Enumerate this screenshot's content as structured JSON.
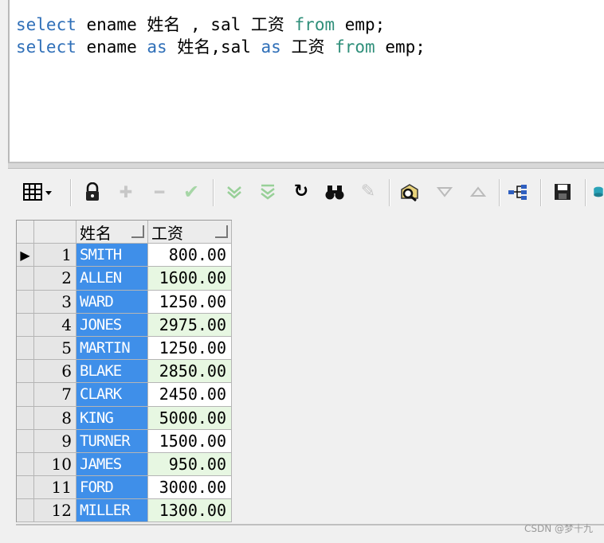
{
  "editor": {
    "lines": [
      [
        "select",
        " ename ",
        "姓名 , sal 工资 ",
        "from",
        " emp;"
      ],
      [
        "select",
        " ename ",
        "as",
        " 姓名,sal ",
        "as",
        " 工资 ",
        "from",
        " emp;"
      ]
    ]
  },
  "toolbar": {
    "buttons": [
      "grid-icon",
      "lock-icon",
      "add-record-icon",
      "delete-record-icon",
      "post-icon",
      "next-record-icon",
      "last-record-icon",
      "refresh-icon",
      "find-icon",
      "clear-icon",
      "query-by-example-icon",
      "sort-desc-icon",
      "sort-asc-icon",
      "link-icon",
      "save-icon"
    ]
  },
  "grid": {
    "columns": [
      "姓名",
      "工资"
    ],
    "rows": [
      {
        "n": "1",
        "name": "SMITH",
        "sal": "800.00"
      },
      {
        "n": "2",
        "name": "ALLEN",
        "sal": "1600.00"
      },
      {
        "n": "3",
        "name": "WARD",
        "sal": "1250.00"
      },
      {
        "n": "4",
        "name": "JONES",
        "sal": "2975.00"
      },
      {
        "n": "5",
        "name": "MARTIN",
        "sal": "1250.00"
      },
      {
        "n": "6",
        "name": "BLAKE",
        "sal": "2850.00"
      },
      {
        "n": "7",
        "name": "CLARK",
        "sal": "2450.00"
      },
      {
        "n": "8",
        "name": "KING",
        "sal": "5000.00"
      },
      {
        "n": "9",
        "name": "TURNER",
        "sal": "1500.00"
      },
      {
        "n": "10",
        "name": "JAMES",
        "sal": "950.00"
      },
      {
        "n": "11",
        "name": "FORD",
        "sal": "3000.00"
      },
      {
        "n": "12",
        "name": "MILLER",
        "sal": "1300.00"
      }
    ],
    "current_row_marker": "▶"
  },
  "watermark": "CSDN @梦十九",
  "colors": {
    "selection": "#3f8fe9",
    "alt_row": "#e7f7e2",
    "keyword": "#2f6fb8"
  }
}
